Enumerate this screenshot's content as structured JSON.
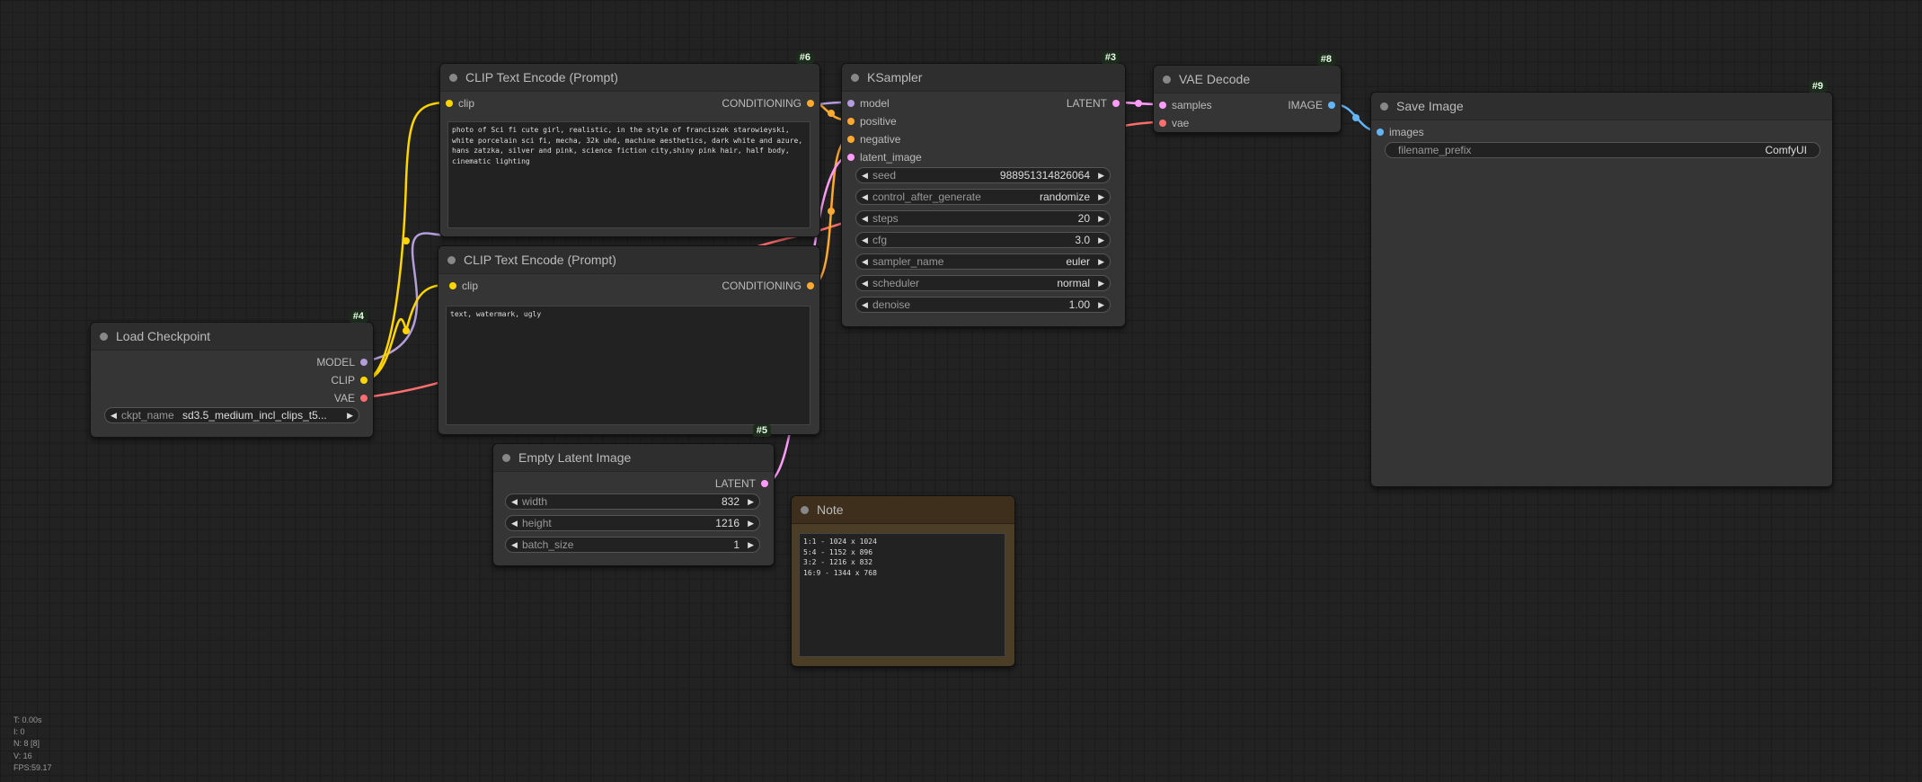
{
  "colors": {
    "background": "#222222",
    "node_body": "#353535",
    "node_title": "#2e2e2e",
    "node_id_badge": "#1d2b1d",
    "model_link": "#b39ddb",
    "clip_link": "#ffd500",
    "vae_link": "#ff6e6e",
    "conditioning_link": "#ffa931",
    "latent_link": "#ff9cf9",
    "image_link": "#64b5f6",
    "note_body": "#4c3d26"
  },
  "nodes": {
    "load_checkpoint": {
      "id": "#4",
      "title": "Load Checkpoint",
      "outputs": [
        "MODEL",
        "CLIP",
        "VAE"
      ],
      "ckpt_name_label": "ckpt_name",
      "ckpt_name_value": "sd3.5_medium_incl_clips_t5..."
    },
    "clip_positive": {
      "id": "#6",
      "title": "CLIP Text Encode (Prompt)",
      "input": "clip",
      "output": "CONDITIONING",
      "text": "photo of Sci fi cute girl, realistic, in the style of franciszek starowieyski, white porcelain sci fi, mecha, 32k uhd, machine aesthetics, dark white and azure, hans zatzka, silver and pink, science fiction city,shiny pink hair, half body, cinematic lighting"
    },
    "clip_negative": {
      "title": "CLIP Text Encode (Prompt)",
      "input": "clip",
      "output": "CONDITIONING",
      "text": "text, watermark, ugly"
    },
    "empty_latent": {
      "id": "#5",
      "title": "Empty Latent Image",
      "output": "LATENT",
      "widgets": [
        {
          "label": "width",
          "value": "832"
        },
        {
          "label": "height",
          "value": "1216"
        },
        {
          "label": "batch_size",
          "value": "1"
        }
      ]
    },
    "ksampler": {
      "id": "#3",
      "title": "KSampler",
      "inputs": [
        "model",
        "positive",
        "negative",
        "latent_image"
      ],
      "output": "LATENT",
      "widgets": [
        {
          "label": "seed",
          "value": "988951314826064"
        },
        {
          "label": "control_after_generate",
          "value": "randomize"
        },
        {
          "label": "steps",
          "value": "20"
        },
        {
          "label": "cfg",
          "value": "3.0"
        },
        {
          "label": "sampler_name",
          "value": "euler"
        },
        {
          "label": "scheduler",
          "value": "normal"
        },
        {
          "label": "denoise",
          "value": "1.00"
        }
      ]
    },
    "vae_decode": {
      "id": "#8",
      "title": "VAE Decode",
      "inputs": [
        "samples",
        "vae"
      ],
      "output": "IMAGE"
    },
    "save_image": {
      "id": "#9",
      "title": "Save Image",
      "input": "images",
      "filename_prefix_label": "filename_prefix",
      "filename_prefix_value": "ComfyUI"
    },
    "note": {
      "title": "Note",
      "text": "1:1 - 1024 x 1024\n5:4 - 1152 x 896\n3:2 - 1216 x 832\n16:9 - 1344 x 768"
    }
  },
  "stats": {
    "t": "T: 0.00s",
    "i": "I: 0",
    "n": "N: 8 [8]",
    "v": "V: 16",
    "fps": "FPS:59.17"
  }
}
